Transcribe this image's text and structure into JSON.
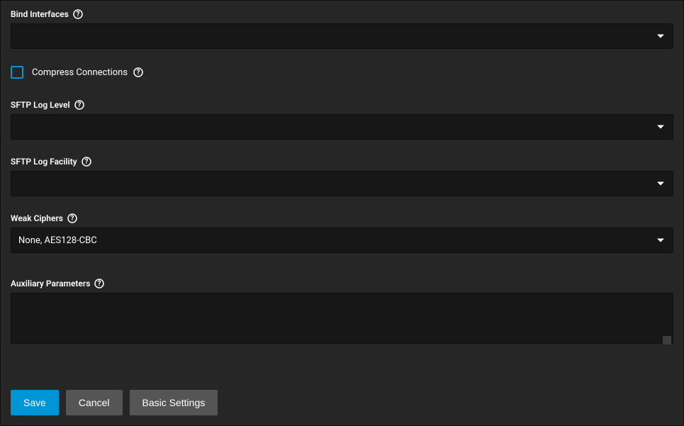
{
  "fields": {
    "bind_interfaces": {
      "label": "Bind Interfaces",
      "value": ""
    },
    "compress_connections": {
      "label": "Compress Connections",
      "checked": false
    },
    "sftp_log_level": {
      "label": "SFTP Log Level",
      "value": ""
    },
    "sftp_log_facility": {
      "label": "SFTP Log Facility",
      "value": ""
    },
    "weak_ciphers": {
      "label": "Weak Ciphers",
      "value": "None, AES128-CBC"
    },
    "auxiliary_parameters": {
      "label": "Auxiliary Parameters",
      "value": ""
    }
  },
  "buttons": {
    "save": "Save",
    "cancel": "Cancel",
    "basic_settings": "Basic Settings"
  }
}
